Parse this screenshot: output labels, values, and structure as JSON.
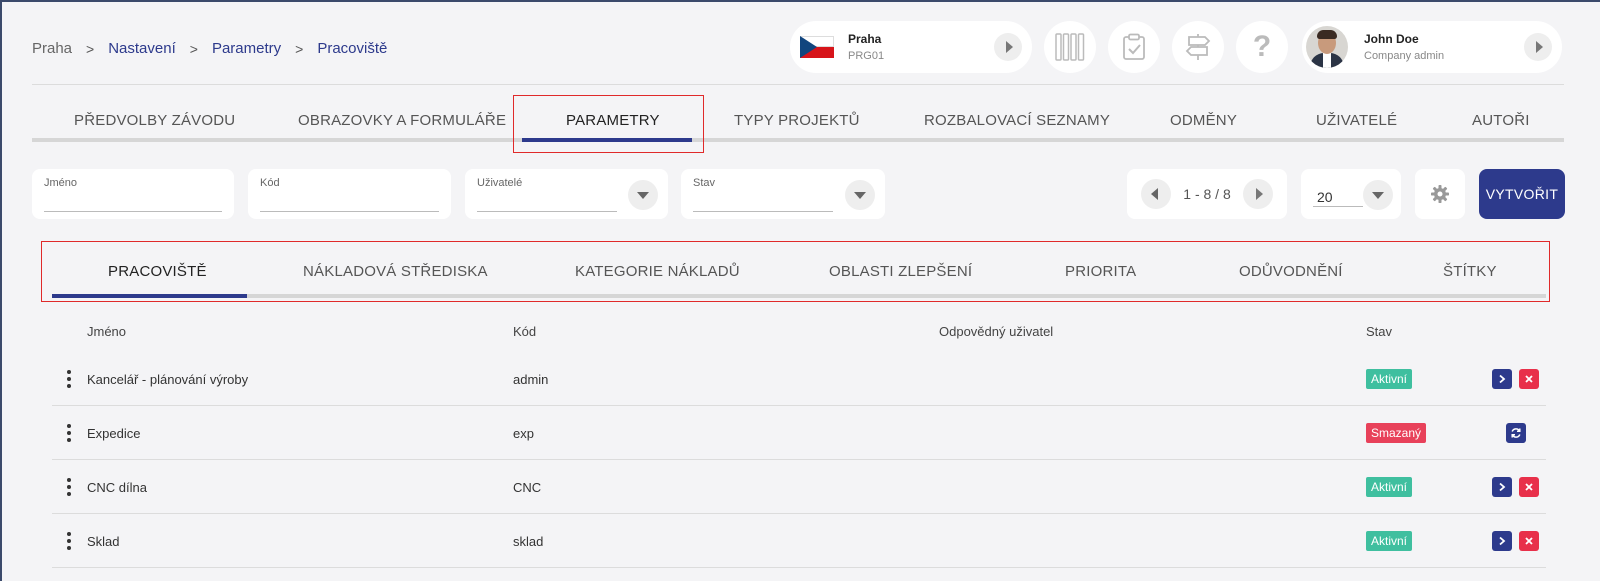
{
  "breadcrumb": [
    "Praha",
    "Nastavení",
    "Parametry",
    "Pracoviště"
  ],
  "location": {
    "name": "Praha",
    "code": "PRG01"
  },
  "user": {
    "name": "John Doe",
    "role": "Company admin"
  },
  "main_tabs": [
    {
      "label": "PŘEDVOLBY ZÁVODU"
    },
    {
      "label": "OBRAZOVKY A FORMULÁŘE"
    },
    {
      "label": "PARAMETRY"
    },
    {
      "label": "TYPY PROJEKTŮ"
    },
    {
      "label": "ROZBALOVACÍ SEZNAMY"
    },
    {
      "label": "ODMĚNY"
    },
    {
      "label": "UŽIVATELÉ"
    },
    {
      "label": "AUTOŘI"
    }
  ],
  "filters": {
    "name": {
      "label": "Jméno",
      "value": ""
    },
    "code": {
      "label": "Kód",
      "value": ""
    },
    "users": {
      "label": "Uživatelé",
      "value": ""
    },
    "status": {
      "label": "Stav",
      "value": ""
    }
  },
  "pagination": {
    "range": "1 - 8 / 8",
    "per_page": "20"
  },
  "create_label": "VYTVOŘIT",
  "sub_tabs": [
    {
      "label": "PRACOVIŠTĚ"
    },
    {
      "label": "NÁKLADOVÁ STŘEDISKA"
    },
    {
      "label": "KATEGORIE NÁKLADŮ"
    },
    {
      "label": "OBLASTI ZLEPŠENÍ"
    },
    {
      "label": "PRIORITA"
    },
    {
      "label": "ODŮVODNĚNÍ"
    },
    {
      "label": "ŠTÍTKY"
    }
  ],
  "table": {
    "headers": {
      "name": "Jméno",
      "code": "Kód",
      "responsible": "Odpovědný uživatel",
      "status": "Stav"
    },
    "rows": [
      {
        "name": "Kancelář - plánování výroby",
        "code": "admin",
        "responsible": "",
        "status": "Aktivní"
      },
      {
        "name": "Expedice",
        "code": "exp",
        "responsible": "",
        "status": "Smazaný"
      },
      {
        "name": "CNC dílna",
        "code": "CNC",
        "responsible": "",
        "status": "Aktivní"
      },
      {
        "name": "Sklad",
        "code": "sklad",
        "responsible": "",
        "status": "Aktivní"
      }
    ]
  },
  "colors": {
    "primary": "#2d3a8c",
    "active_badge": "#3fbf9f",
    "deleted_badge": "#e8415a",
    "highlight": "#e02a2a"
  }
}
